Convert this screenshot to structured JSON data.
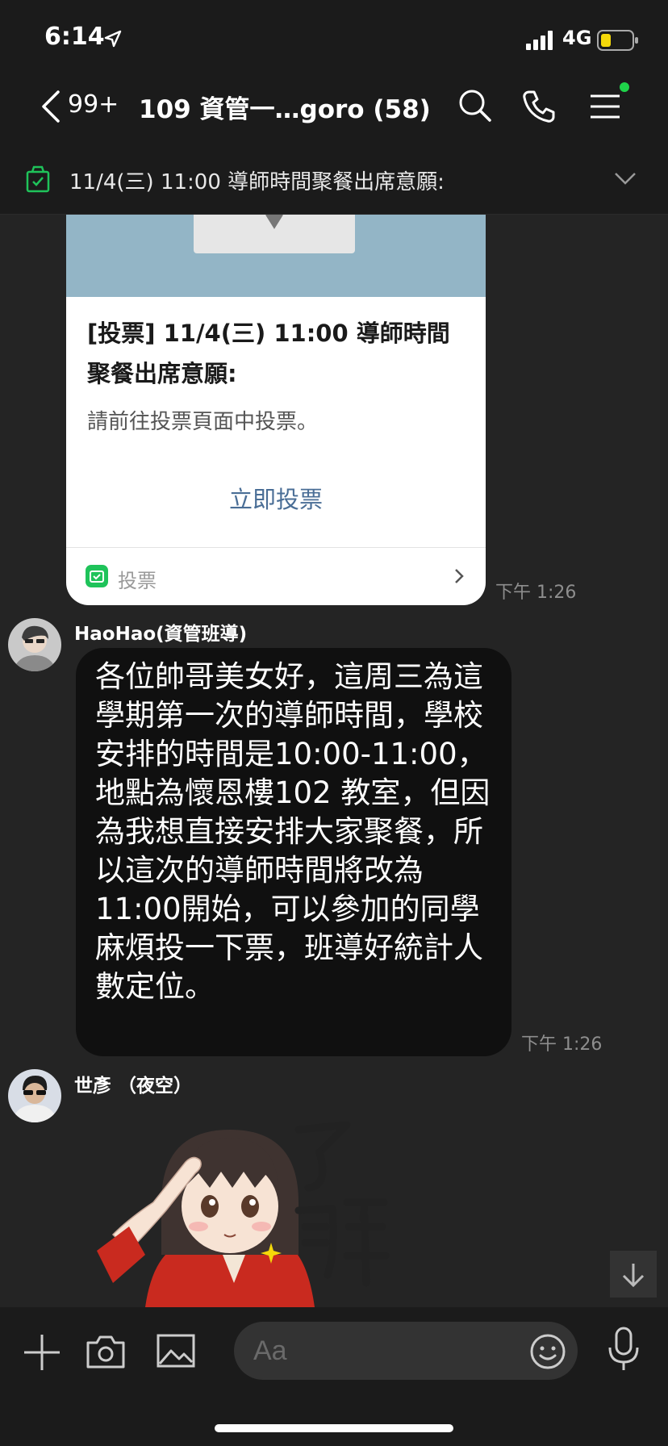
{
  "status_bar": {
    "time": "6:14",
    "network": "4G"
  },
  "header": {
    "unread_count": "99+",
    "chat_title": "109 資管一…goro (58)"
  },
  "announcement": {
    "text": "11/4(三) 11:00 導師時間聚餐出席意願:"
  },
  "messages": [
    {
      "type": "poll-card",
      "title": "[投票] 11/4(三) 11:00 導師時間聚餐出席意願:",
      "subtitle": "請前往投票頁面中投票。",
      "action_label": "立即投票",
      "footer_label": "投票",
      "time": "下午 1:26"
    },
    {
      "type": "text",
      "sender": "HaoHao(資管班導)",
      "text": "各位帥哥美女好，這周三為這學期第一次的導師時間，學校安排的時間是10:00-11:00，地點為懷恩樓102 教室，但因為我想直接安排大家聚餐，所以這次的導師時間將改為11:00開始，可以參加的同學麻煩投一下票，班導好統計人數定位。",
      "time": "下午 1:26"
    },
    {
      "type": "sticker",
      "sender": "世彥 （夜空）",
      "sticker_text": "了解"
    }
  ],
  "composer": {
    "placeholder": "Aa"
  },
  "icons": {
    "back": "chevron-left-icon",
    "search": "search-icon",
    "call": "phone-icon",
    "menu": "hamburger-menu-icon",
    "plus": "plus-icon",
    "camera": "camera-icon",
    "gallery": "image-icon",
    "emoji": "smiley-icon",
    "mic": "microphone-icon",
    "scroll": "arrow-down-icon"
  },
  "colors": {
    "background": "#242424",
    "bar": "#1b1b1b",
    "bubble": "#101010",
    "accent_green": "#1fd44a",
    "poll_action": "#4a6e96",
    "battery_level": "#f5d90a"
  },
  "battery_level": 0.3
}
